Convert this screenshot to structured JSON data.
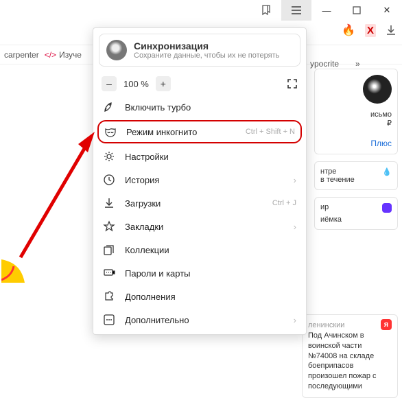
{
  "titlebar": {
    "min": "—",
    "max": "▢",
    "close": "✕"
  },
  "toolbar": {
    "ext1": "🔥",
    "ext2": "X",
    "dl": "⬇"
  },
  "bookmarks": {
    "bm1": "carpenter",
    "bm2": "Изуче",
    "bm3": "ypocrite",
    "more": "»"
  },
  "sync": {
    "title": "Синхронизация",
    "subtitle": "Сохраните данные, чтобы их не потерять"
  },
  "zoom": {
    "minus": "–",
    "value": "100 %",
    "plus": "+"
  },
  "menu": {
    "turbo": "Включить турбо",
    "incognito": "Режим инкогнито",
    "incognito_sc": "Ctrl + Shift + N",
    "settings": "Настройки",
    "history": "История",
    "downloads": "Загрузки",
    "downloads_sc": "Ctrl + J",
    "bookmarks": "Закладки",
    "collections": "Коллекции",
    "passwords": "Пароли и карты",
    "addons": "Дополнения",
    "more": "Дополнительно"
  },
  "widgets": {
    "w1a": "исьмо",
    "w1b": "₽",
    "plus": "Плюс",
    "w2a": "нтре",
    "w2b": "в течение",
    "w3a": "ир",
    "w3b": "иёмка",
    "news_h": "ленинскии",
    "news": "Под Ачинском в воинской части №74008 на складе боеприпасов произошел пожар с последующими"
  }
}
